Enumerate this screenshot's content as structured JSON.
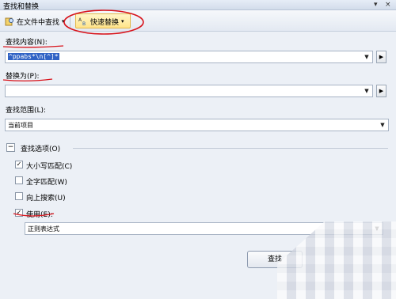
{
  "window": {
    "title": "查找和替换",
    "pin_glyph": "▾",
    "pin_glyph2": "×"
  },
  "toolbar": {
    "find_in_files_label": "在文件中查找",
    "quick_replace_label": "快速替换",
    "dropdown_glyph": "▾"
  },
  "find": {
    "label": "查找内容(N):",
    "value": "^ppabs*\\n[^]*"
  },
  "replace": {
    "label": "替换为(P):",
    "value": ""
  },
  "scope": {
    "label": "查找范围(L):",
    "value": "当前项目"
  },
  "options": {
    "label": "查找选项(O)",
    "expander_glyph": "−",
    "match_case": {
      "label": "大小写匹配(C)",
      "checked": true
    },
    "whole_word": {
      "label": "全字匹配(W)",
      "checked": false
    },
    "search_up": {
      "label": "向上搜索(U)",
      "checked": false
    },
    "use": {
      "label": "使用(E):",
      "checked": true
    },
    "use_type": "正则表达式"
  },
  "buttons": {
    "find_next": "查找"
  },
  "glyphs": {
    "arrow_down": "▼",
    "arrow_right": "▶",
    "check": "✓"
  },
  "colors": {
    "annotation_red": "#d8141c",
    "selection_blue": "#3163c5"
  }
}
